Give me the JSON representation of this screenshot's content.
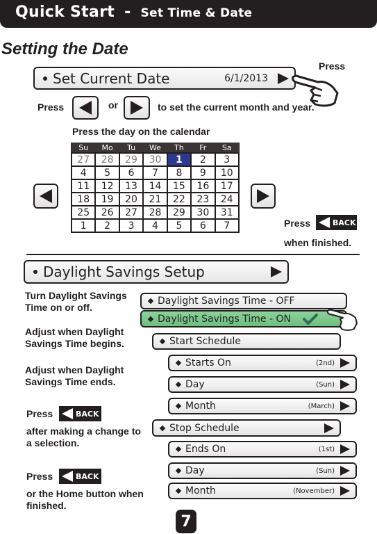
{
  "header": {
    "title": "Quick Start",
    "separator": "-",
    "subtitle": "Set Time & Date"
  },
  "section_title": "Setting the Date",
  "set_date": {
    "label": "Set Current Date",
    "value": "6/1/2013",
    "press_label": "Press"
  },
  "nav_instruction": {
    "press": "Press",
    "or": "or",
    "text": "to set the current month and year."
  },
  "calendar_instruction": "Press the day on the calendar",
  "calendar": {
    "weekdays": [
      "Su",
      "Mo",
      "Tu",
      "We",
      "Th",
      "Fr",
      "Sa"
    ],
    "weeks": [
      [
        "27",
        "28",
        "29",
        "30",
        "1",
        "2",
        "3"
      ],
      [
        "4",
        "5",
        "6",
        "7",
        "8",
        "9",
        "10"
      ],
      [
        "11",
        "12",
        "13",
        "14",
        "15",
        "16",
        "17"
      ],
      [
        "18",
        "19",
        "20",
        "21",
        "22",
        "23",
        "24"
      ],
      [
        "25",
        "26",
        "27",
        "28",
        "29",
        "30",
        "31"
      ],
      [
        "1",
        "2",
        "3",
        "4",
        "5",
        "6",
        "7"
      ]
    ],
    "selected_day": "1",
    "selected_color": "#2b3990"
  },
  "back_note_date": {
    "press": "Press",
    "back_label": "BACK",
    "text": "when finished."
  },
  "dst_setup": {
    "label": "Daylight Savings Setup"
  },
  "notes": {
    "toggle": "Turn Daylight Savings Time on or off.",
    "begins": "Adjust when Daylight Savings Time begins.",
    "ends": "Adjust when Daylight Savings Time ends.",
    "back1_press": "Press",
    "back1_text": "after making a change to a selection.",
    "back2_press": "Press",
    "back2_text": "or the Home button when finished.",
    "back_label": "BACK"
  },
  "dst_options": {
    "off": "Daylight Savings Time - OFF",
    "on": "Daylight Savings Time - ON",
    "on_color": "#7cc98a"
  },
  "start_schedule": {
    "label": "Start Schedule",
    "items": [
      {
        "label": "Starts On",
        "value": "(2nd)"
      },
      {
        "label": "Day",
        "value": "(Sun)"
      },
      {
        "label": "Month",
        "value": "(March)"
      }
    ]
  },
  "stop_schedule": {
    "label": "Stop Schedule",
    "items": [
      {
        "label": "Ends On",
        "value": "(1st)"
      },
      {
        "label": "Day",
        "value": "(Sun)"
      },
      {
        "label": "Month",
        "value": "(November)"
      }
    ]
  },
  "page_number": "7"
}
